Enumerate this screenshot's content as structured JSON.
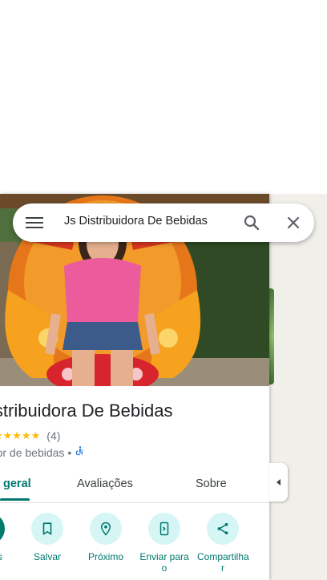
{
  "search": {
    "query": "Js Distribuidora De Bebidas"
  },
  "place": {
    "title": "istribuidora De Bebidas",
    "stars": "★★★★★",
    "review_count": "(4)",
    "category": "edor de bebidas",
    "separator": "•",
    "rating": 5
  },
  "tabs": {
    "overview": "geral",
    "reviews": "Avaliações",
    "about": "Sobre"
  },
  "actions": {
    "routes": "s",
    "save": "Salvar",
    "nearby": "Próximo",
    "send_line1": "Enviar para",
    "send_line2": "o",
    "share_line1": "Compartilha",
    "share_line2": "r"
  },
  "colors": {
    "accent": "#01796f",
    "accent_light": "#d6f6f5",
    "star": "#fbbc04"
  },
  "icons": [
    "menu-icon",
    "search-icon",
    "close-icon",
    "accessibility-icon",
    "bookmark-icon",
    "nearby-icon",
    "send-to-phone-icon",
    "share-icon",
    "collapse-arrow-icon"
  ]
}
